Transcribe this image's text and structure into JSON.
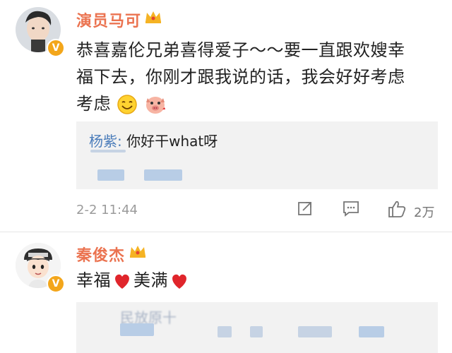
{
  "comment1": {
    "username": "演员马可",
    "text_line1": "恭喜嘉伦兄弟喜得爱子～～要一直跟欢嫂幸",
    "text_line2": "福下去，你刚才跟我说的话，我会好好考虑",
    "text_line3": "考虑",
    "reply": {
      "name": "杨紫",
      "separator": ":",
      "text": "你好干what呀"
    },
    "time": "2-2 11:44",
    "likes": "2万"
  },
  "comment2": {
    "username": "秦俊杰",
    "text_part1": "幸福",
    "text_part2": "美满",
    "reply_partial": "民放原十"
  },
  "colors": {
    "username": "#eb7350",
    "reply_name": "#4a7cba",
    "verified": "#f3a61b",
    "heart": "#e0252b"
  },
  "icons": [
    "verified-badge-icon",
    "vip-crown-icon",
    "smile-emoji-icon",
    "pig-emoji-icon",
    "share-icon",
    "comment-icon",
    "like-icon",
    "heart-icon"
  ]
}
